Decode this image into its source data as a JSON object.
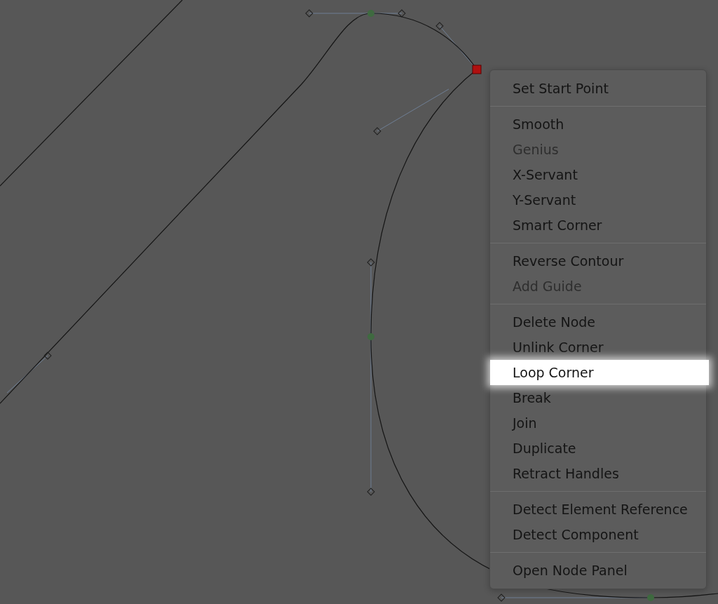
{
  "context_menu": {
    "sections": [
      {
        "items": [
          {
            "label": "Set Start Point",
            "disabled": false,
            "selected": false
          }
        ]
      },
      {
        "items": [
          {
            "label": "Smooth",
            "disabled": false,
            "selected": false
          },
          {
            "label": "Genius",
            "disabled": true,
            "selected": false
          },
          {
            "label": "X-Servant",
            "disabled": false,
            "selected": false
          },
          {
            "label": "Y-Servant",
            "disabled": false,
            "selected": false
          },
          {
            "label": "Smart Corner",
            "disabled": false,
            "selected": false
          }
        ]
      },
      {
        "items": [
          {
            "label": "Reverse Contour",
            "disabled": false,
            "selected": false
          },
          {
            "label": "Add Guide",
            "disabled": true,
            "selected": false
          }
        ]
      },
      {
        "items": [
          {
            "label": "Delete Node",
            "disabled": false,
            "selected": false
          },
          {
            "label": "Unlink Corner",
            "disabled": false,
            "selected": false
          },
          {
            "label": "Loop Corner",
            "disabled": false,
            "selected": true
          },
          {
            "label": "Break",
            "disabled": false,
            "selected": false
          },
          {
            "label": "Join",
            "disabled": false,
            "selected": false
          },
          {
            "label": "Duplicate",
            "disabled": false,
            "selected": false
          },
          {
            "label": "Retract Handles",
            "disabled": false,
            "selected": false
          }
        ]
      },
      {
        "items": [
          {
            "label": "Detect Element Reference",
            "disabled": false,
            "selected": false
          },
          {
            "label": "Detect Component",
            "disabled": false,
            "selected": false
          }
        ]
      },
      {
        "items": [
          {
            "label": "Open Node Panel",
            "disabled": false,
            "selected": false
          }
        ]
      }
    ]
  }
}
